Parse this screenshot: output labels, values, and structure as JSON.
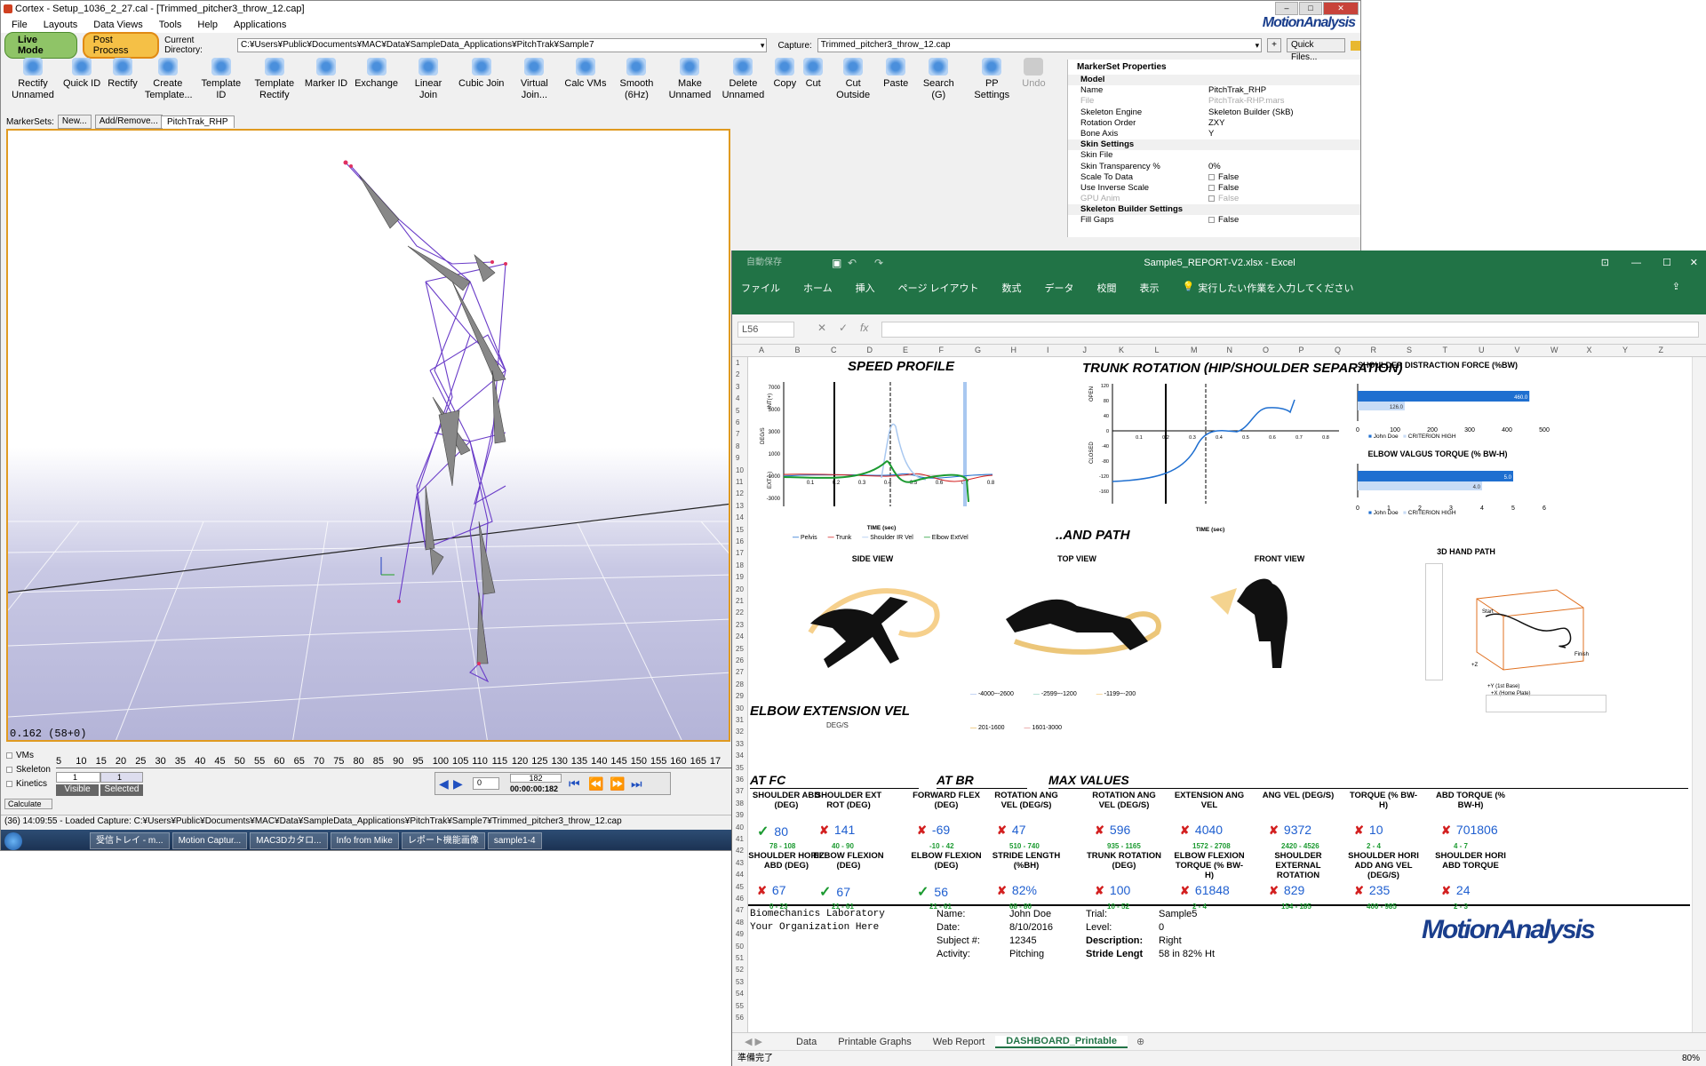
{
  "cortex": {
    "title": "Cortex - Setup_1036_2_27.cal - [Trimmed_pitcher3_throw_12.cap]",
    "menu": [
      "File",
      "Layouts",
      "Data Views",
      "Tools",
      "Help",
      "Applications"
    ],
    "logo": "MotionAnalysis",
    "live_mode": "Live Mode",
    "post_process": "Post Process",
    "current_dir_label": "Current Directory:",
    "current_dir": "C:¥Users¥Public¥Documents¥MAC¥Data¥SampleData_Applications¥PitchTrak¥Sample7",
    "capture_label": "Capture:",
    "capture": "Trimmed_pitcher3_throw_12.cap",
    "quick_files": "Quick Files...",
    "tools": [
      {
        "label": "Rectify Unnamed",
        "icon": "rectify-unnamed-icon"
      },
      {
        "label": "Quick ID",
        "icon": "quick-id-icon"
      },
      {
        "label": "Rectify",
        "icon": "rectify-icon"
      },
      {
        "label": "Create Template...",
        "icon": "create-template-icon"
      },
      {
        "label": "Template ID",
        "icon": "template-id-icon"
      },
      {
        "label": "Template Rectify",
        "icon": "template-rectify-icon"
      },
      {
        "label": "Marker ID",
        "icon": "marker-id-icon"
      },
      {
        "label": "Exchange",
        "icon": "exchange-icon"
      },
      {
        "label": "Linear Join",
        "icon": "linear-join-icon"
      },
      {
        "label": "Cubic Join",
        "icon": "cubic-join-icon"
      },
      {
        "label": "Virtual Join...",
        "icon": "virtual-join-icon"
      },
      {
        "label": "Calc VMs",
        "icon": "calc-vms-icon"
      },
      {
        "label": "Smooth (6Hz)",
        "icon": "smooth-icon"
      },
      {
        "label": "Make Unnamed",
        "icon": "make-unnamed-icon"
      },
      {
        "label": "Delete Unnamed",
        "icon": "delete-unnamed-icon"
      },
      {
        "label": "Copy",
        "icon": "copy-icon"
      },
      {
        "label": "Cut",
        "icon": "cut-icon"
      },
      {
        "label": "Cut Outside",
        "icon": "cut-outside-icon"
      },
      {
        "label": "Paste",
        "icon": "paste-icon"
      },
      {
        "label": "Search (G)",
        "icon": "search-icon"
      },
      {
        "label": "PP Settings",
        "icon": "pp-settings-icon"
      },
      {
        "label": "Undo",
        "icon": "undo-icon"
      }
    ],
    "markersets_label": "MarkerSets:",
    "new_btn": "New...",
    "add_remove_btn": "Add/Remove...",
    "markerset_tab": "PitchTrak_RHP",
    "viewport_status": "0.162 (58+0)",
    "props": {
      "title": "MarkerSet Properties",
      "rows": [
        {
          "k": "Model",
          "v": "",
          "sec": true
        },
        {
          "k": "Name",
          "v": "PitchTrak_RHP"
        },
        {
          "k": "File",
          "v": "PitchTrak-RHP.mars",
          "dim": true
        },
        {
          "k": "Skeleton Engine",
          "v": "Skeleton Builder (SkB)"
        },
        {
          "k": "Rotation Order",
          "v": "ZXY"
        },
        {
          "k": "Bone Axis",
          "v": "Y"
        },
        {
          "k": "Skin Settings",
          "v": "",
          "sec": true
        },
        {
          "k": "Skin File",
          "v": ""
        },
        {
          "k": "Skin Transparency %",
          "v": "0%"
        },
        {
          "k": "Scale To Data",
          "v": "False",
          "cb": true
        },
        {
          "k": "Use Inverse Scale",
          "v": "False",
          "cb": true
        },
        {
          "k": "GPU Anim",
          "v": "False",
          "cb": true,
          "dim": true
        },
        {
          "k": "Skeleton Builder Settings",
          "v": "",
          "sec": true
        },
        {
          "k": "Fill Gaps",
          "v": "False",
          "cb": true
        }
      ]
    },
    "timeline": {
      "checks": [
        "VMs",
        "Skeleton",
        "Kinetics"
      ],
      "ticks": [
        "5",
        "10",
        "15",
        "20",
        "25",
        "30",
        "35",
        "40",
        "45",
        "50",
        "55",
        "60",
        "65",
        "70",
        "75",
        "80",
        "85",
        "90",
        "95",
        "100",
        "105",
        "110",
        "115",
        "120",
        "125",
        "130",
        "135",
        "140",
        "145",
        "150",
        "155",
        "160",
        "165",
        "17"
      ],
      "visible_val": "1",
      "selected_val": "1",
      "visible": "Visible",
      "selected": "Selected",
      "frame": "0",
      "frame_count": "182",
      "time": "00:00:00:182",
      "calculate": "Calculate"
    },
    "log": "(36) 14:09:55 - Loaded Capture: C:¥Users¥Public¥Documents¥MAC¥Data¥SampleData_Applications¥PitchTrak¥Sample7¥Trimmed_pitcher3_throw_12.cap",
    "taskbar": [
      "受信トレイ - m...",
      "Motion Captur...",
      "MAC3Dカタロ...",
      "Info from Mike",
      "レポート機能画像",
      "sample1-4"
    ]
  },
  "excel": {
    "autosave": "自動保存",
    "title": "Sample5_REPORT-V2.xlsx - Excel",
    "ribbon_tabs": [
      "ファイル",
      "ホーム",
      "挿入",
      "ページ レイアウト",
      "数式",
      "データ",
      "校閲",
      "表示"
    ],
    "tell_me": "実行したい作業を入力してください",
    "name_box": "L56",
    "columns": [
      "A",
      "B",
      "C",
      "D",
      "E",
      "F",
      "G",
      "H",
      "I",
      "J",
      "K",
      "L",
      "M",
      "N",
      "O",
      "P",
      "Q",
      "R",
      "S",
      "T",
      "U",
      "V",
      "W",
      "X",
      "Y",
      "Z"
    ],
    "speed_profile": {
      "title": "SPEED PROFILE",
      "ylabel": "DEG/S",
      "ext": "EXT (-)",
      "int": "INT(+)",
      "xlabel": "TIME (sec)",
      "yticks": [
        "7000",
        "5000",
        "3000",
        "1000",
        "-1000",
        "-3000"
      ],
      "xticks": [
        "0.1",
        "0.2",
        "0.3",
        "0.4",
        "0.5",
        "0.6",
        "0.7",
        "0.8"
      ],
      "legend": [
        "Pelvis",
        "Trunk",
        "Shoulder IR Vel",
        "Elbow ExtVel"
      ],
      "legend_colors": [
        "#1f6fd0",
        "#d32020",
        "#a9c8f0",
        "#1b9a30"
      ]
    },
    "trunk_rotation": {
      "title": "TRUNK ROTATION (HIP/SHOULDER SEPARATION)",
      "open": "OPEN",
      "closed": "CLOSED",
      "xlabel": "TIME (sec)",
      "yticks": [
        "120",
        "80",
        "40",
        "0",
        "-40",
        "-80",
        "-120",
        "-160"
      ],
      "xticks": [
        "0.1",
        "0.2",
        "0.3",
        "0.4",
        "0.5",
        "0.6",
        "0.7",
        "0.8"
      ]
    },
    "shoulder_distraction": {
      "title": "SHOULDER DISTRACTION FORCE (%BW)",
      "values": [
        "460.0",
        "126.0"
      ],
      "ticks": [
        "0",
        "100",
        "200",
        "300",
        "400",
        "500"
      ],
      "legend": [
        "John Doe",
        "CRITERION HIGH"
      ]
    },
    "elbow_valgus": {
      "title": "ELBOW VALGUS TORQUE (% BW-H)",
      "values": [
        "5.0",
        "4.0"
      ],
      "ticks": [
        "0",
        "1",
        "2",
        "3",
        "4",
        "5",
        "6"
      ],
      "legend": [
        "John Doe",
        "CRITERION HIGH"
      ]
    },
    "path_title": "..AND PATH",
    "views": [
      "SIDE VIEW",
      "TOP VIEW",
      "FRONT VIEW",
      "3D HAND PATH"
    ],
    "hand_path": {
      "start": "Start",
      "finish": "Finish",
      "axis_y": "+Y (1st Base)",
      "axis_x": "+X (Home Plate)",
      "axis_z": "+Z"
    },
    "path_legend": [
      "-4000~-2600",
      "-2599~-1200",
      "-1199~-200",
      "201-1600",
      "1601-3000"
    ],
    "path_legend_colors": [
      "#8aa8e8",
      "#6ac0a8",
      "#f0b040",
      "#e0a020",
      "#d86060"
    ],
    "elbow_ext": {
      "title": "ELBOW EXTENSION VEL",
      "unit": "DEG/S"
    },
    "sections": [
      "AT FC",
      "AT BR",
      "MAX VALUES"
    ],
    "metrics_row1": [
      {
        "h": "SHOULDER ABD (DEG)",
        "v": "80",
        "ok": true,
        "r": "78 - 108"
      },
      {
        "h": "SHOULDER EXT ROT (DEG)",
        "v": "141",
        "ok": false,
        "r": "40 - 90"
      },
      {
        "h": "FORWARD FLEX (DEG)",
        "v": "-69",
        "ok": false,
        "r": "-10 - 42"
      },
      {
        "h": "ROTATION ANG VEL (DEG/S)",
        "v": "47",
        "ok": false,
        "r": "510 - 740"
      },
      {
        "h": "ROTATION ANG VEL (DEG/S)",
        "v": "596",
        "ok": false,
        "r": "935 - 1165"
      },
      {
        "h": "EXTENSION ANG VEL",
        "v": "4040",
        "ok": false,
        "r": "1572 - 2708"
      },
      {
        "h": "ANG VEL (DEG/S)",
        "v": "9372",
        "ok": false,
        "r": "2420 - 4526"
      },
      {
        "h": "TORQUE (% BW-H)",
        "v": "10",
        "ok": false,
        "r": "2 - 4"
      },
      {
        "h": "ABD TORQUE (% BW-H)",
        "v": "701806",
        "ok": false,
        "r": "4 - 7"
      }
    ],
    "metrics_row2": [
      {
        "h": "SHOULDER HORIZ ABD (DEG)",
        "v": "67",
        "ok": false,
        "r": "0 - 23"
      },
      {
        "h": "ELBOW FLEXION (DEG)",
        "v": "67",
        "ok": true,
        "r": "21 - 61"
      },
      {
        "h": "ELBOW FLEXION (DEG)",
        "v": "56",
        "ok": true,
        "r": "21 - 61"
      },
      {
        "h": "STRIDE LENGTH (%BH)",
        "v": "82%",
        "ok": false,
        "r": "68 - 80"
      },
      {
        "h": "TRUNK ROTATION (DEG)",
        "v": "100",
        "ok": false,
        "r": "10 - 52"
      },
      {
        "h": "ELBOW FLEXION TORQUE (% BW-H)",
        "v": "61848",
        "ok": false,
        "r": "2 - 4"
      },
      {
        "h": "SHOULDER EXTERNAL ROTATION",
        "v": "829",
        "ok": false,
        "r": "154 - 185"
      },
      {
        "h": "SHOULDER HORI ADD ANG VEL (DEG/S)",
        "v": "235",
        "ok": false,
        "r": "400 - 985"
      },
      {
        "h": "SHOULDER HORI ABD TORQUE",
        "v": "24",
        "ok": false,
        "r": "2 - 3"
      }
    ],
    "footer": {
      "lab": "Biomechanics Laboratory",
      "org": "Your Organization Here",
      "name_k": "Name:",
      "name_v": "John Doe",
      "date_k": "Date:",
      "date_v": "8/10/2016",
      "subj_k": "Subject #:",
      "subj_v": "12345",
      "act_k": "Activity:",
      "act_v": "Pitching",
      "trial_k": "Trial:",
      "trial_v": "Sample5",
      "level_k": "Level:",
      "level_v": "0",
      "desc_k": "Description:",
      "desc_v": "Right",
      "stride_k": "Stride Lengt",
      "stride_v": "58 in",
      "stride_pct": "82% Ht",
      "logo": "MotionAnalysis"
    },
    "sheets": [
      "Data",
      "Printable Graphs",
      "Web Report",
      "DASHBOARD_Printable"
    ],
    "status": "準備完了",
    "zoom": "80%"
  }
}
